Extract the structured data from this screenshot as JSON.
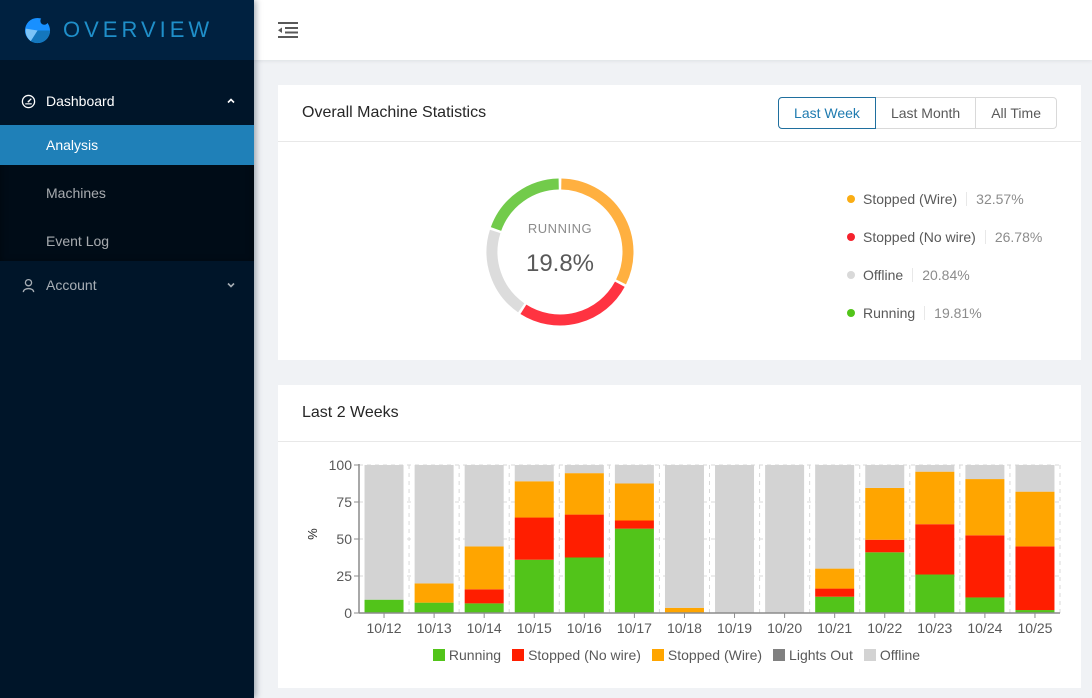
{
  "app": {
    "logo_text": "OVERVIEW"
  },
  "sidebar": {
    "items": [
      {
        "label": "Dashboard",
        "icon": "dashboard-icon",
        "expanded": true,
        "children": [
          {
            "label": "Analysis",
            "active": true
          },
          {
            "label": "Machines",
            "active": false
          },
          {
            "label": "Event Log",
            "active": false
          }
        ]
      },
      {
        "label": "Account",
        "icon": "user-icon",
        "expanded": false
      }
    ]
  },
  "header": {
    "trigger_icon": "menu-fold-icon"
  },
  "overall": {
    "title": "Overall Machine Statistics",
    "ranges": [
      {
        "label": "Last Week",
        "active": true
      },
      {
        "label": "Last Month",
        "active": false
      },
      {
        "label": "All Time",
        "active": false
      }
    ],
    "center_label": "RUNNING",
    "center_value": "19.8%",
    "legend": [
      {
        "name": "Stopped (Wire)",
        "pct": "32.57%",
        "value": 32.57,
        "color": "#faad14"
      },
      {
        "name": "Stopped (No wire)",
        "pct": "26.78%",
        "value": 26.78,
        "color": "#f5222d"
      },
      {
        "name": "Offline",
        "pct": "20.84%",
        "value": 20.84,
        "color": "#d9d9d9"
      },
      {
        "name": "Running",
        "pct": "19.81%",
        "value": 19.81,
        "color": "#52c41a"
      }
    ]
  },
  "weeks": {
    "title": "Last 2 Weeks"
  },
  "chart_data": [
    {
      "type": "pie",
      "subtype": "donut",
      "title": "Overall Machine Statistics",
      "labels": [
        "Stopped (Wire)",
        "Stopped (No wire)",
        "Offline",
        "Running"
      ],
      "values": [
        32.57,
        26.78,
        20.84,
        19.81
      ],
      "colors": [
        "#ffb040",
        "#ff3341",
        "#dcdcdc",
        "#72cb4b"
      ],
      "center_text": [
        "RUNNING",
        "19.8%"
      ],
      "legend_position": "right"
    },
    {
      "type": "bar",
      "stacked": true,
      "title": "Last 2 Weeks",
      "xlabel": "",
      "ylabel": "%",
      "ylim": [
        0,
        100
      ],
      "yticks": [
        0,
        25,
        50,
        75,
        100
      ],
      "grid": true,
      "legend_position": "bottom",
      "categories": [
        "10/12",
        "10/13",
        "10/14",
        "10/15",
        "10/16",
        "10/17",
        "10/18",
        "10/19",
        "10/20",
        "10/21",
        "10/22",
        "10/23",
        "10/24",
        "10/25"
      ],
      "series": [
        {
          "name": "Running",
          "color": "#52c41a",
          "values": [
            9,
            7,
            6.5,
            36,
            37.5,
            57,
            0,
            0,
            0,
            11,
            41,
            26,
            10.5,
            2
          ]
        },
        {
          "name": "Stopped (No wire)",
          "color": "#ff1e00",
          "values": [
            0,
            0,
            9.5,
            28.5,
            29,
            5.5,
            0,
            0,
            0,
            5.5,
            8.5,
            34,
            42,
            43
          ]
        },
        {
          "name": "Stopped (Wire)",
          "color": "#ffa500",
          "values": [
            0,
            13,
            29,
            24.5,
            28,
            25,
            3.5,
            0,
            0,
            13.5,
            35,
            35.5,
            38,
            37
          ]
        },
        {
          "name": "Lights Out",
          "color": "#808080",
          "values": [
            0,
            0,
            0,
            0,
            0,
            0,
            0,
            0,
            0,
            0,
            0,
            0,
            0,
            0
          ]
        },
        {
          "name": "Offline",
          "color": "#d3d3d3",
          "values": [
            91,
            80,
            55,
            11,
            5.5,
            12.5,
            96.5,
            100,
            100,
            70,
            15.5,
            4.5,
            9.5,
            18
          ]
        }
      ]
    }
  ]
}
